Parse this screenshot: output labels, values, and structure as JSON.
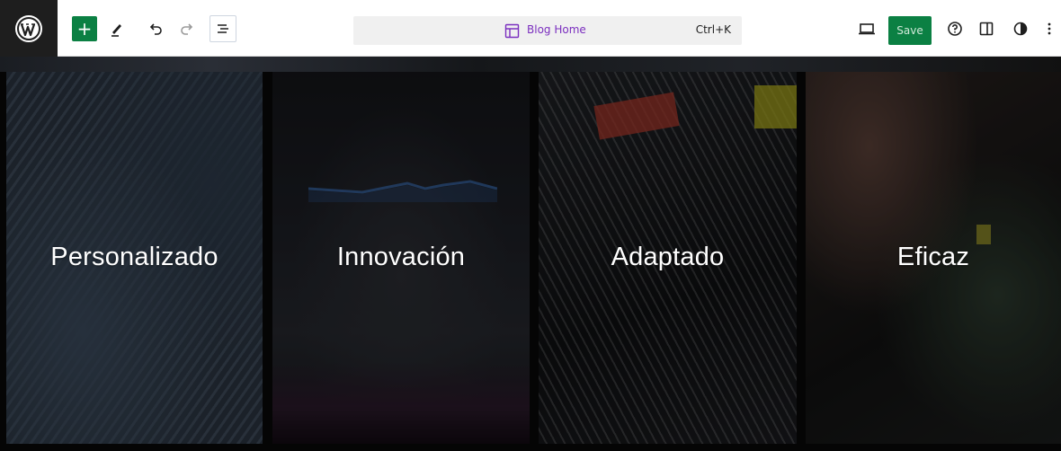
{
  "toolbar": {
    "logo": "wordpress-logo-icon",
    "add_label": "+",
    "command_bar": {
      "title": "Blog Home",
      "shortcut": "Ctrl+K",
      "icon": "layout-icon"
    },
    "save_label": "Save",
    "colors": {
      "accent_green": "#0b8043",
      "command_title": "#7b2fbf",
      "logo_bg": "#1e1e1e"
    }
  },
  "canvas": {
    "panels": [
      {
        "label": "Personalizado"
      },
      {
        "label": "Innovación"
      },
      {
        "label": "Adaptado"
      },
      {
        "label": "Eficaz"
      }
    ]
  }
}
